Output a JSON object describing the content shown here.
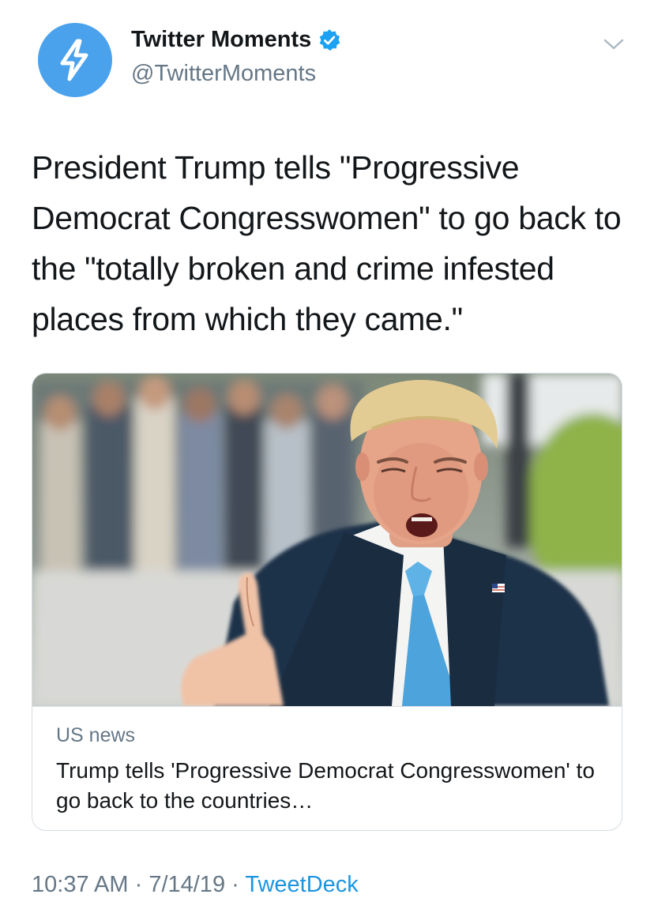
{
  "header": {
    "display_name": "Twitter Moments",
    "handle": "@TwitterMoments",
    "avatar_icon": "lightning-bolt-icon",
    "verified_icon": "verified-badge-icon",
    "menu_icon": "chevron-down-icon"
  },
  "tweet": {
    "text": "President Trump tells \"Progressive Democrat Congresswomen\" to go back to the \"totally broken and crime infested places from which they came.\""
  },
  "card": {
    "domain": "US news",
    "title": "Trump tells 'Progressive Democrat Congresswomen' to go back to the countries…"
  },
  "meta": {
    "time": "10:37 AM",
    "separator_1": " · ",
    "date": "7/14/19",
    "separator_2": " · ",
    "source": "TweetDeck"
  },
  "colors": {
    "accent": "#1b95e0",
    "avatar_bg": "#4aa1ec",
    "muted_text": "#657786",
    "border": "#d6dde3"
  }
}
